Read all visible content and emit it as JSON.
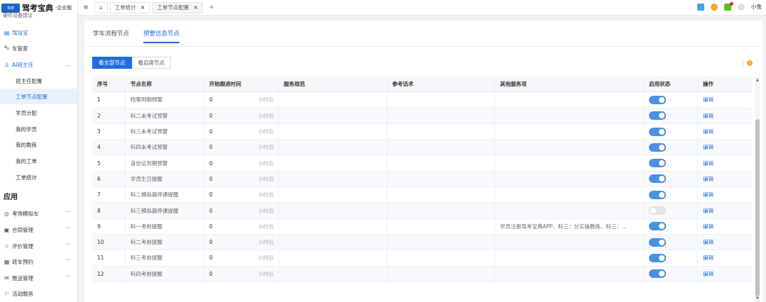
{
  "app": {
    "title": "驾考宝典",
    "edition": "·企业版",
    "logo_mark": "驾考"
  },
  "sidebar": {
    "cut_item": "硬件设备建议",
    "items": [
      {
        "label": "驾培宝",
        "icon": "document-icon"
      },
      {
        "label": "车管家",
        "icon": "car-icon"
      },
      {
        "label": "AI班主任",
        "icon": "user-icon"
      }
    ],
    "sub_items": [
      "班主任配置",
      "工单节点配置",
      "学员分配",
      "我的学员",
      "我的教练",
      "我的工单",
      "工单统计"
    ],
    "group_title": "应用",
    "app_items": [
      {
        "label": "考场模拟车",
        "icon": "target-icon"
      },
      {
        "label": "合同管理",
        "icon": "contract-icon"
      },
      {
        "label": "评价管理",
        "icon": "star-icon"
      },
      {
        "label": "班车预约",
        "icon": "bus-icon"
      },
      {
        "label": "推送管理",
        "icon": "mail-icon"
      },
      {
        "label": "活动服务",
        "icon": "flag-icon"
      }
    ]
  },
  "topbar": {
    "tabs": [
      {
        "label": "工单统计"
      },
      {
        "label": "工单节点配置"
      }
    ],
    "user_name": "小兔"
  },
  "panel": {
    "subtabs": [
      "学车流程节点",
      "预警信息节点"
    ],
    "buttons": [
      "看全部节点",
      "看启用节点"
    ],
    "help": "?"
  },
  "table": {
    "columns": [
      "序号",
      "节点名称",
      "开始跟进时间",
      "服务规范",
      "参考话术",
      "其他服务项",
      "启用状态",
      "操作"
    ],
    "unit": "小时后",
    "edit_label": "编辑",
    "rows": [
      {
        "no": "1",
        "name": "档案到期预警",
        "hours": "0",
        "spec": "",
        "script": "",
        "other": "",
        "enabled": true
      },
      {
        "no": "2",
        "name": "科二未考试预警",
        "hours": "0",
        "spec": "",
        "script": "",
        "other": "",
        "enabled": true
      },
      {
        "no": "3",
        "name": "科三未考试预警",
        "hours": "0",
        "spec": "",
        "script": "",
        "other": "",
        "enabled": true
      },
      {
        "no": "4",
        "name": "科四未考试预警",
        "hours": "0",
        "spec": "",
        "script": "",
        "other": "",
        "enabled": true
      },
      {
        "no": "5",
        "name": "身份证到期预警",
        "hours": "0",
        "spec": "",
        "script": "",
        "other": "",
        "enabled": true
      },
      {
        "no": "6",
        "name": "学员生日提醒",
        "hours": "0",
        "spec": "",
        "script": "",
        "other": "",
        "enabled": true
      },
      {
        "no": "7",
        "name": "科二模拟器停课提醒",
        "hours": "0",
        "spec": "",
        "script": "",
        "other": "",
        "enabled": true
      },
      {
        "no": "8",
        "name": "科三模拟器停课提醒",
        "hours": "0",
        "spec": "",
        "script": "",
        "other": "",
        "enabled": false
      },
      {
        "no": "9",
        "name": "科一考前提醒",
        "hours": "0",
        "spec": "",
        "script": "",
        "other": "学员注册驾考宝典APP、科三：分实操教练、科三：...",
        "enabled": true
      },
      {
        "no": "10",
        "name": "科二考前提醒",
        "hours": "0",
        "spec": "",
        "script": "",
        "other": "",
        "enabled": true
      },
      {
        "no": "11",
        "name": "科三考前提醒",
        "hours": "0",
        "spec": "",
        "script": "",
        "other": "",
        "enabled": true
      },
      {
        "no": "12",
        "name": "科四考前提醒",
        "hours": "0",
        "spec": "",
        "script": "",
        "other": "",
        "enabled": true
      }
    ]
  },
  "colors": {
    "accent": "#1e6fd9",
    "toggle_on": "#4a90e2",
    "toggle_off": "#e4e4e4"
  }
}
